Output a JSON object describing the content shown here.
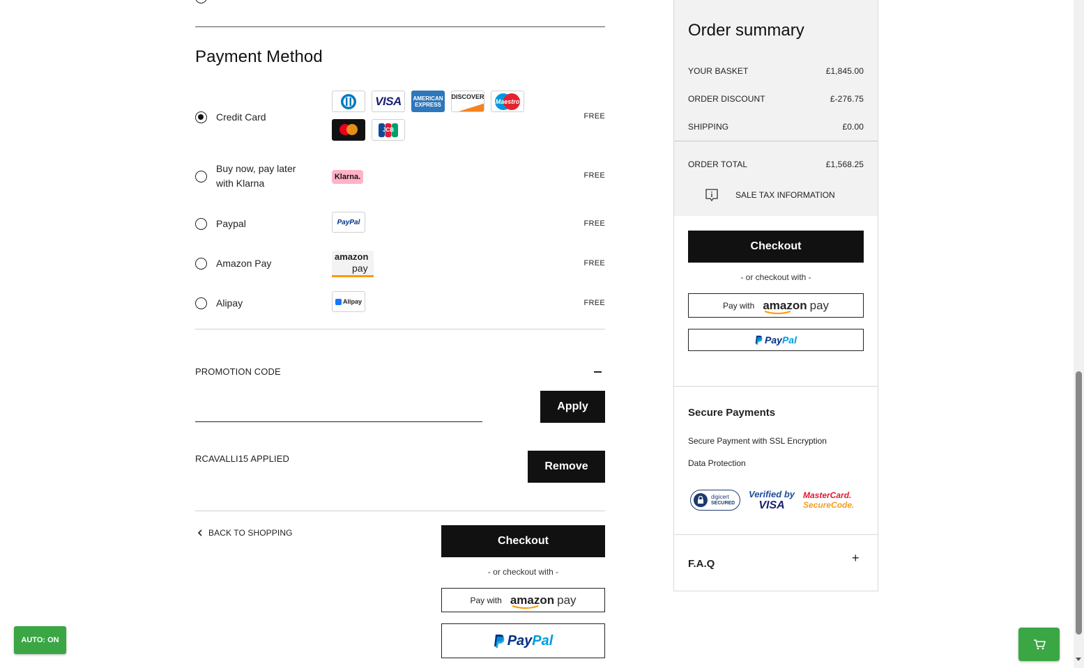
{
  "payment": {
    "title": "Payment Method",
    "methods": [
      {
        "label": "Credit Card",
        "fee": "FREE",
        "selected": true
      },
      {
        "label": "Buy now, pay later with Klarna",
        "fee": "FREE",
        "selected": false
      },
      {
        "label": "Paypal",
        "fee": "FREE",
        "selected": false
      },
      {
        "label": "Amazon Pay",
        "fee": "FREE",
        "selected": false
      },
      {
        "label": "Alipay",
        "fee": "FREE",
        "selected": false
      }
    ],
    "logos": {
      "visa": "VISA",
      "amex_line1": "AMERICAN",
      "amex_line2": "EXPRESS",
      "discover": "DISCOVER",
      "maestro": "Maestro",
      "jcb": "JCB",
      "klarna": "Klarna.",
      "paypal_small": "PayPal",
      "amazon_word": "amazon",
      "amazon_pay": "pay",
      "alipay": "Alipay"
    }
  },
  "promo": {
    "label": "PROMOTION CODE",
    "input_value": "",
    "apply_label": "Apply",
    "applied_text": "RCAVALLI15 APPLIED",
    "remove_label": "Remove"
  },
  "footer_actions": {
    "back_label": "BACK TO SHOPPING",
    "checkout_label": "Checkout",
    "or_text": "- or checkout with -",
    "pay_with": "Pay with",
    "amazon_word": "amazon",
    "amazon_pay": "pay",
    "paypal_pay": "Pay",
    "paypal_pal": "Pal"
  },
  "summary": {
    "title": "Order summary",
    "rows": [
      {
        "label": "YOUR BASKET",
        "value": "£1,845.00"
      },
      {
        "label": "ORDER DISCOUNT",
        "value": "£-276.75"
      },
      {
        "label": "SHIPPING",
        "value": "£0.00"
      }
    ],
    "total": {
      "label": "ORDER TOTAL",
      "value": "£1,568.25"
    },
    "tax_info": "SALE TAX INFORMATION",
    "checkout_label": "Checkout",
    "or_text": "- or checkout with -",
    "pay_with": "Pay with",
    "amazon_word": "amazon",
    "amazon_pay": "pay",
    "paypal_pay": "Pay",
    "paypal_pal": "Pal"
  },
  "secure": {
    "title": "Secure Payments",
    "line1": "Secure Payment with SSL Encryption",
    "line2": "Data Protection",
    "digicert_1": "digicert",
    "digicert_2": "SECURED",
    "verified_1": "Verified by",
    "verified_2": "VISA",
    "mc_1": "MasterCard.",
    "mc_2": "SecureCode."
  },
  "faq": {
    "label": "F.A.Q",
    "toggle": "+"
  },
  "widgets": {
    "auto_label": "AUTO: ON"
  },
  "colors": {
    "black": "#111111",
    "green": "#3aa644",
    "paypal_dark": "#003087",
    "paypal_light": "#009cde",
    "amazon_orange": "#ff9900"
  }
}
